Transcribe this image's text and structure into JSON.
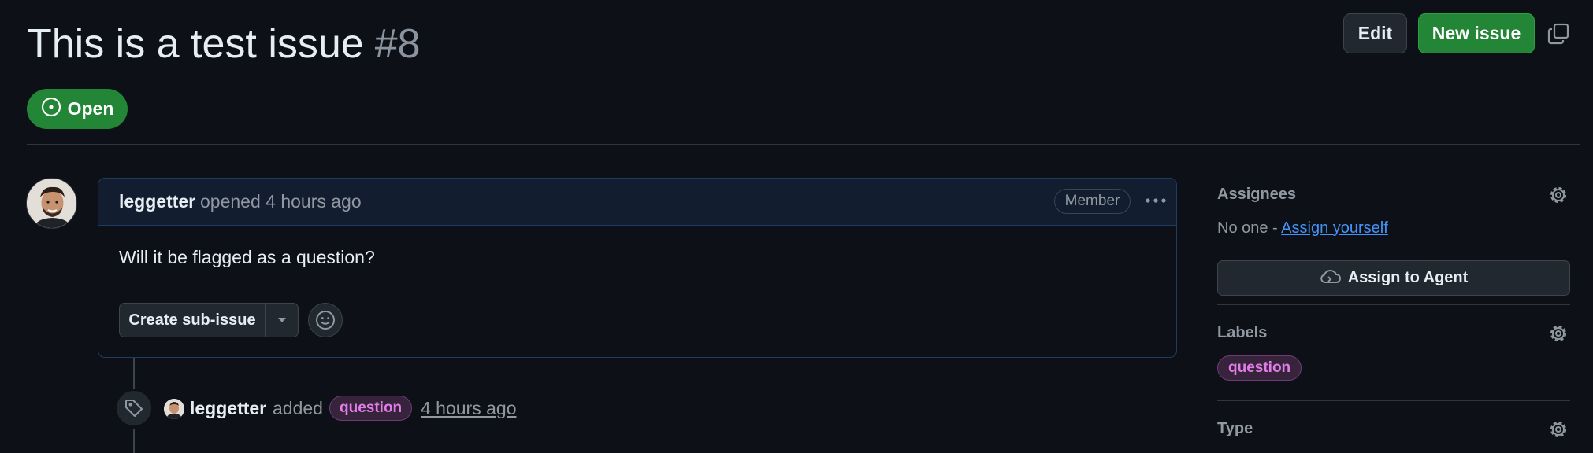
{
  "issue": {
    "title": "This is a test issue",
    "number": "#8",
    "state": "Open"
  },
  "header": {
    "edit_label": "Edit",
    "new_issue_label": "New issue"
  },
  "comment": {
    "author": "leggetter",
    "meta": "opened 4 hours ago",
    "role_badge": "Member",
    "body": "Will it be flagged as a question?",
    "create_subissue_label": "Create sub-issue"
  },
  "timeline_event": {
    "actor": "leggetter",
    "verb": "added",
    "label": "question",
    "time": "4 hours ago"
  },
  "sidebar": {
    "assignees": {
      "heading": "Assignees",
      "none_text": "No one -",
      "assign_yourself": "Assign yourself",
      "assign_agent_label": "Assign to Agent"
    },
    "labels": {
      "heading": "Labels",
      "items": [
        "question"
      ]
    },
    "type": {
      "heading": "Type"
    }
  },
  "colors": {
    "background": "#0d1117",
    "open_green": "#238636",
    "label_question_fg": "#e17de6",
    "label_question_bg": "#38233d",
    "link_blue": "#4493f8"
  },
  "icons": {
    "state": "issue-opened-icon",
    "copy": "copy-icon",
    "kebab": "kebab-horizontal-icon",
    "dropdown": "triangle-down-icon",
    "emoji": "smiley-icon",
    "tag": "tag-icon",
    "agent": "cloud-agent-icon",
    "settings": "gear-icon"
  }
}
